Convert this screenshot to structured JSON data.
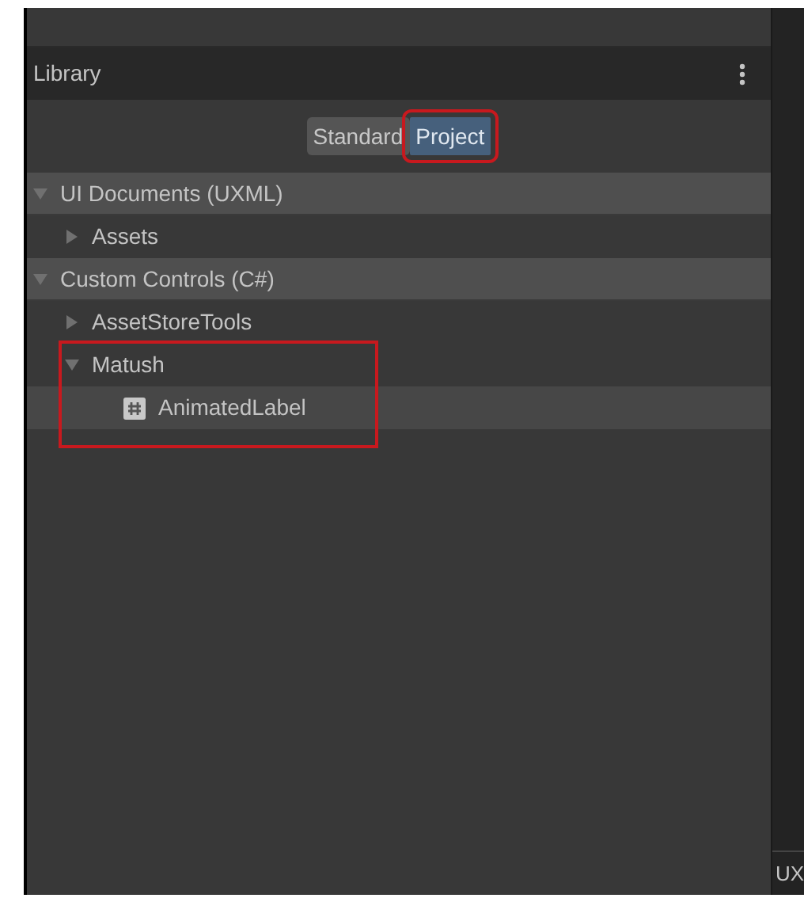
{
  "panel": {
    "title": "Library"
  },
  "tabs": [
    {
      "label": "Standard",
      "selected": false,
      "outlined": false
    },
    {
      "label": "Project",
      "selected": true,
      "outlined": true
    }
  ],
  "sections": [
    {
      "label": "UI Documents (UXML)",
      "expanded": true,
      "children": [
        {
          "label": "Assets",
          "kind": "folder",
          "expanded": false,
          "selected": false,
          "outlined": false
        }
      ]
    },
    {
      "label": "Custom Controls (C#)",
      "expanded": true,
      "children": [
        {
          "label": "AssetStoreTools",
          "kind": "folder",
          "expanded": false,
          "selected": false,
          "outlined": false
        },
        {
          "label": "Matush",
          "kind": "folder",
          "expanded": true,
          "selected": false,
          "outlined": true,
          "children": [
            {
              "label": "AnimatedLabel",
              "kind": "control",
              "selected": true
            }
          ]
        }
      ]
    }
  ],
  "side_panel": {
    "label": "UX"
  }
}
